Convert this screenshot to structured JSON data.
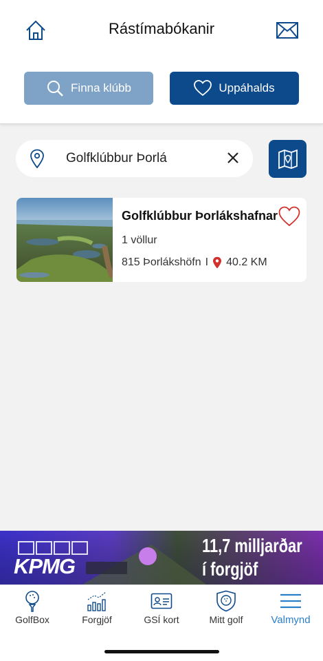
{
  "header": {
    "title": "Rástímabókanir",
    "find_club_label": "Finna klúbb",
    "favorites_label": "Uppáhalds"
  },
  "search": {
    "value": "Golfklúbbur Þorlá"
  },
  "result": {
    "name": "Golfklúbbur Þorlákshafnar",
    "courses": "1 völlur",
    "postal": "815 Þorlákshöfn",
    "separator": "I",
    "distance": "40.2 KM"
  },
  "banner": {
    "brand": "KPMG",
    "headline_line1": "11,7 milljarðar",
    "headline_line2": "í forgjöf"
  },
  "tabbar": {
    "items": [
      {
        "label": "GolfBox",
        "icon": "golf-ball-tee-icon"
      },
      {
        "label": "Forgjöf",
        "icon": "bar-chart-icon"
      },
      {
        "label": "GSÍ kort",
        "icon": "id-card-icon"
      },
      {
        "label": "Mitt golf",
        "icon": "shield-golf-icon"
      },
      {
        "label": "Valmynd",
        "icon": "menu-icon"
      }
    ]
  },
  "colors": {
    "primary": "#0d4a8c",
    "primary_light": "#7fa3c6",
    "accent_red": "#d0312d",
    "active_tab": "#2a7fc9"
  }
}
